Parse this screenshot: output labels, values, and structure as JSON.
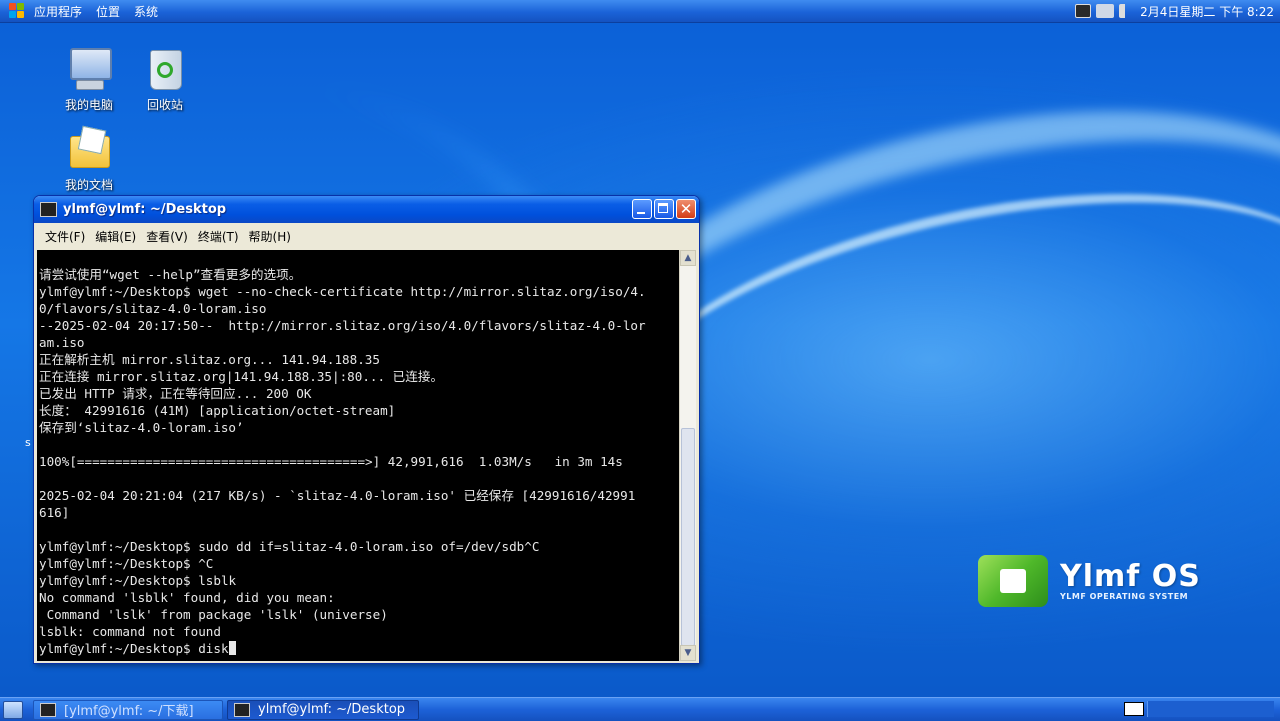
{
  "top_panel": {
    "menus": [
      "应用程序",
      "位置",
      "系统"
    ],
    "clock": "2月4日星期二 下午 8:22"
  },
  "desktop": {
    "icons": [
      {
        "label": "我的电脑",
        "icon": "computer-icon"
      },
      {
        "label": "回收站",
        "icon": "recycle-bin-icon"
      },
      {
        "label": "我的文档",
        "icon": "documents-folder-icon"
      }
    ],
    "stray_char": "s"
  },
  "window": {
    "title": "ylmf@ylmf: ~/Desktop",
    "menus": [
      "文件(F)",
      "编辑(E)",
      "查看(V)",
      "终端(T)",
      "帮助(H)"
    ],
    "terminal_lines": [
      "请尝试使用“wget --help”查看更多的选项。",
      "ylmf@ylmf:~/Desktop$ wget --no-check-certificate http://mirror.slitaz.org/iso/4.",
      "0/flavors/slitaz-4.0-loram.iso",
      "--2025-02-04 20:17:50--  http://mirror.slitaz.org/iso/4.0/flavors/slitaz-4.0-lor",
      "am.iso",
      "正在解析主机 mirror.slitaz.org... 141.94.188.35",
      "正在连接 mirror.slitaz.org|141.94.188.35|:80... 已连接。",
      "已发出 HTTP 请求，正在等待回应... 200 OK",
      "长度： 42991616 (41M) [application/octet-stream]",
      "保存到‘slitaz-4.0-loram.iso’",
      "",
      "100%[======================================>] 42,991,616  1.03M/s   in 3m 14s",
      "",
      "2025-02-04 20:21:04 (217 KB/s) - `slitaz-4.0-loram.iso' 已经保存 [42991616/42991",
      "616]",
      "",
      "ylmf@ylmf:~/Desktop$ sudo dd if=slitaz-4.0-loram.iso of=/dev/sdb^C",
      "ylmf@ylmf:~/Desktop$ ^C",
      "ylmf@ylmf:~/Desktop$ lsblk",
      "No command 'lsblk' found, did you mean:",
      " Command 'lslk' from package 'lslk' (universe)",
      "lsblk: command not found"
    ],
    "prompt_line": "ylmf@ylmf:~/Desktop$ disk"
  },
  "brand": {
    "name": "Ylmf OS",
    "subtitle": "YLMF OPERATING SYSTEM"
  },
  "taskbar": {
    "tasks": [
      {
        "label": "[ylmf@ylmf: ~/下载]",
        "active": false
      },
      {
        "label": "ylmf@ylmf: ~/Desktop",
        "active": true
      }
    ]
  },
  "colors": {
    "desktop_blue": "#0b5fd6",
    "terminal_bg": "#000000",
    "terminal_fg": "#e8e8e8",
    "brand_green": "#4fb82a"
  }
}
